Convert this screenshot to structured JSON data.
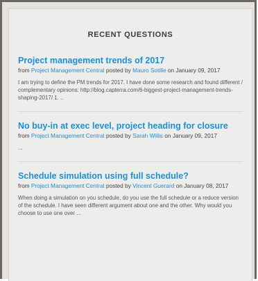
{
  "widget": {
    "heading": "RECENT QUESTIONS"
  },
  "questions": [
    {
      "title": "Project management trends of 2017",
      "from_text": "from",
      "source": "Project Management Central",
      "posted_text": "posted by",
      "author": "Mauro Sotille",
      "on_text": "on",
      "date": "January 09, 2017",
      "excerpt": "I am trying to define the PM trends for 2017. I have done some research and found different / complementary opinions: http://blog.capterra.com/6-biggest-project-management-trends-shaping-2017/ 1. .."
    },
    {
      "title": "No buy-in at exec level, project heading for closure",
      "from_text": "from",
      "source": "Project Management Central",
      "posted_text": "posted by",
      "author": "Sarah Willis",
      "on_text": "on",
      "date": "January 09, 2017",
      "excerpt": "..."
    },
    {
      "title": "Schedule simulation using full schedule?",
      "from_text": "from",
      "source": "Project Management Central",
      "posted_text": "posted by",
      "author": "Vincent Guerard",
      "on_text": "on",
      "date": "January 08, 2017",
      "excerpt": "When doing a simulation on you schedule, do you use the full schedule or a reduce version of the schedule. I have seen different argument about one and the other. Why would you choose to use one over ..."
    }
  ]
}
